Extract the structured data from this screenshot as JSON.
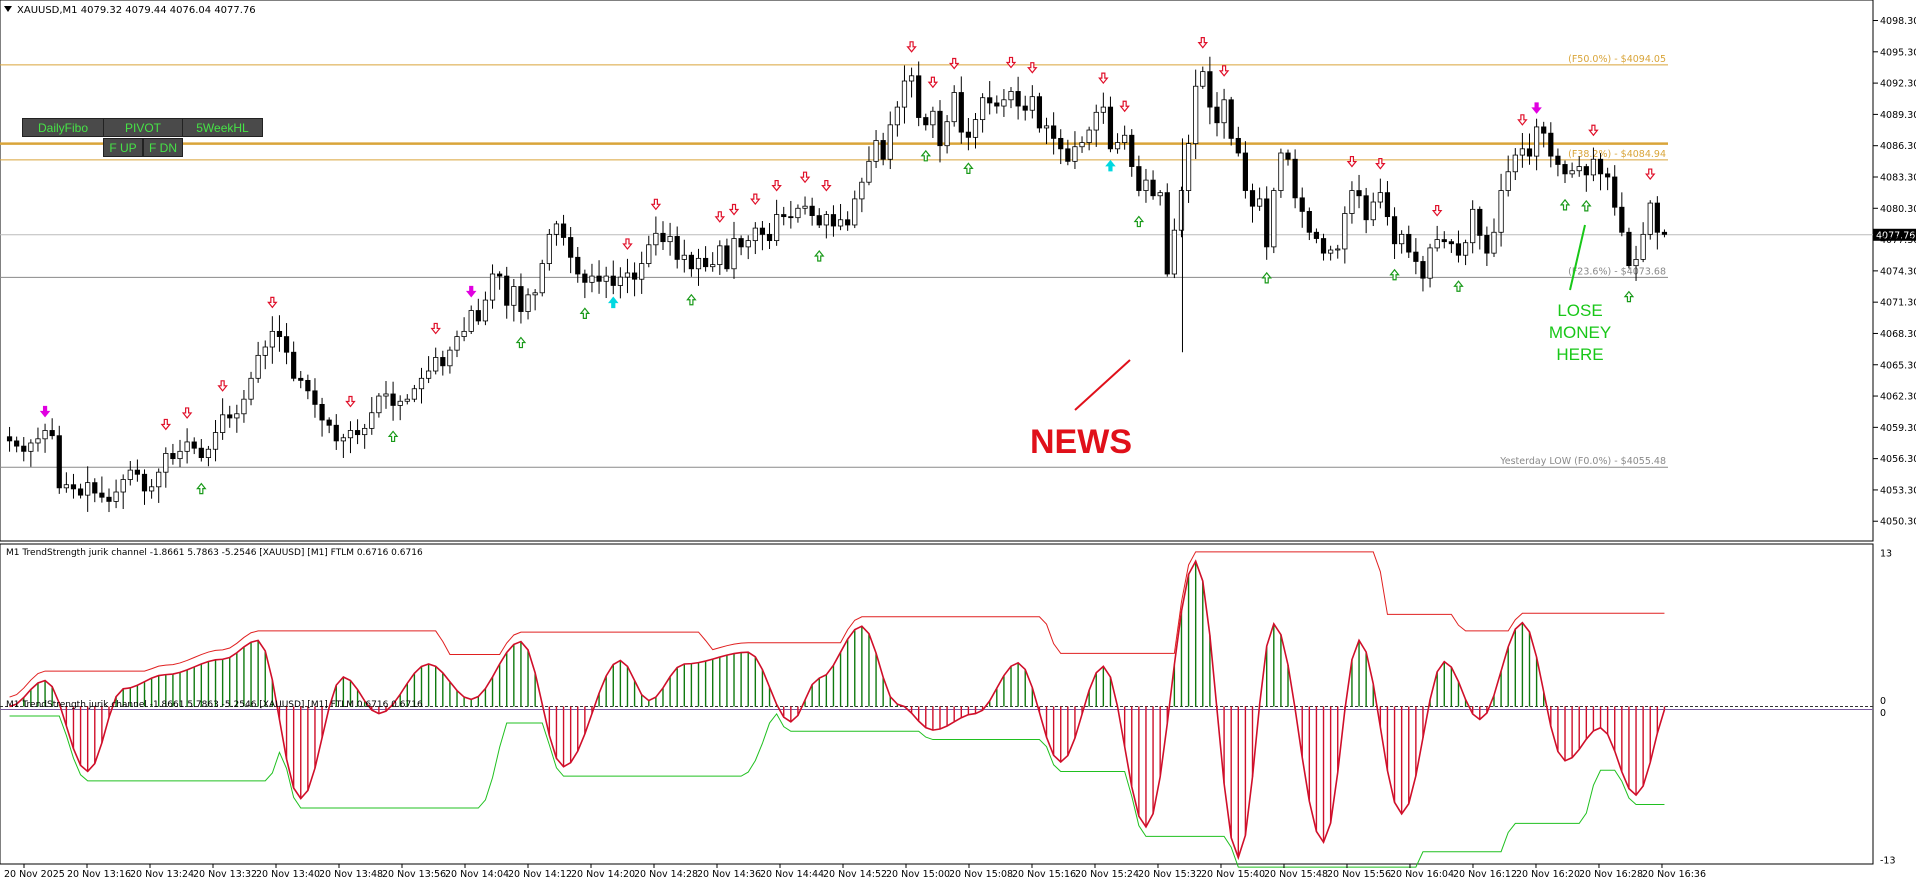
{
  "window": {
    "title_line": "XAUUSD,M1  4079.32 4079.44 4076.04 4077.76",
    "menu_icon": "triangle-down-icon"
  },
  "buttons": {
    "daily_fibo": "DailyFibo",
    "pivot": "PIVOT",
    "five_week_hl": "5WeekHL",
    "f_up": "F UP",
    "f_dn": "F DN"
  },
  "annotations": {
    "news": "NEWS",
    "lose_money": [
      "LOSE",
      "MONEY",
      "HERE"
    ]
  },
  "colors": {
    "bull_arrow": "#1a9a1a",
    "bear_arrow": "#e0102a",
    "cyan_arrow": "#00d8e0",
    "magenta_arrow": "#e000e0",
    "fibo_line": "#d9a53a",
    "bull_hist": "#0f7a0f",
    "bear_hist": "#d00f2a"
  },
  "chart_data": [
    {
      "type": "candlestick",
      "symbol": "XAUUSD",
      "timeframe": "M1",
      "ohlc_current": {
        "open": 4079.32,
        "high": 4079.44,
        "low": 4076.04,
        "close": 4077.76
      },
      "current_price_label": "4077.76",
      "ylim": [
        4048.5,
        4099.5
      ],
      "y_ticks": [
        "4098.30",
        "4095.30",
        "4092.30",
        "4089.30",
        "4086.30",
        "4083.30",
        "4080.30",
        "4077.30",
        "4074.30",
        "4071.30",
        "4068.30",
        "4065.30",
        "4062.30",
        "4059.30",
        "4056.30",
        "4053.30",
        "4050.30"
      ],
      "levels": [
        {
          "label": "(F50.0%) - $4094.05",
          "price": 4094.05,
          "color": "#d9a53a",
          "width": 1
        },
        {
          "label": "",
          "price": 4086.5,
          "color": "#d9a53a",
          "width": 2.5
        },
        {
          "label": "(F38.2%) - $4084.94",
          "price": 4084.94,
          "color": "#d9a53a",
          "width": 1
        },
        {
          "label": "(F23.6%) - $4073.68",
          "price": 4073.68,
          "color": "#8a8a8a",
          "width": 1
        },
        {
          "label": "Yesterday LOW (F0.0%) - $4055.48",
          "price": 4055.48,
          "color": "#8a8a8a",
          "width": 1
        }
      ],
      "close_series": [
        4058.0,
        4057.5,
        4057.0,
        4057.8,
        4058.2,
        4059.0,
        4058.5,
        4053.5,
        4053.8,
        4053.4,
        4052.8,
        4054.0,
        4053.0,
        4052.6,
        4052.2,
        4053.1,
        4054.3,
        4055.2,
        4054.8,
        4053.2,
        4053.6,
        4055.0,
        4056.8,
        4056.3,
        4057.0,
        4057.9,
        4057.3,
        4056.4,
        4057.2,
        4058.8,
        4060.5,
        4060.2,
        4060.6,
        4062.0,
        4064.0,
        4066.2,
        4067.0,
        4068.5,
        4068.0,
        4066.5,
        4064.0,
        4063.8,
        4062.8,
        4061.5,
        4060.0,
        4059.5,
        4058.0,
        4058.3,
        4059.0,
        4058.6,
        4059.2,
        4060.7,
        4062.3,
        4062.5,
        4061.4,
        4061.8,
        4062.0,
        4063.0,
        4064.0,
        4064.7,
        4066.0,
        4065.2,
        4066.7,
        4068.0,
        4068.5,
        4070.5,
        4069.5,
        4071.5,
        4074.0,
        4073.8,
        4071.0,
        4072.8,
        4070.4,
        4072.0,
        4072.2,
        4075.0,
        4077.8,
        4078.8,
        4077.5,
        4075.6,
        4074.0,
        4073.2,
        4073.8,
        4073.3,
        4073.8,
        4072.9,
        4073.7,
        4074.1,
        4073.5,
        4075.0,
        4076.8,
        4077.9,
        4077.1,
        4077.6,
        4075.4,
        4075.8,
        4074.5,
        4075.5,
        4074.7,
        4074.9,
        4076.7,
        4074.5,
        4077.4,
        4076.6,
        4077.2,
        4078.4,
        4077.8,
        4077.2,
        4079.7,
        4079.5,
        4079.4,
        4080.3,
        4080.5,
        4079.6,
        4078.7,
        4079.7,
        4078.6,
        4079.2,
        4078.7,
        4081.2,
        4082.8,
        4084.8,
        4086.8,
        4085.0,
        4088.3,
        4090.0,
        4092.5,
        4093.0,
        4089.0,
        4088.3,
        4089.6,
        4086.3,
        4088.6,
        4091.4,
        4087.6,
        4087.1,
        4088.8,
        4090.9,
        4090.4,
        4090.1,
        4090.7,
        4091.5,
        4090.1,
        4089.7,
        4091.0,
        4088.0,
        4088.2,
        4087.0,
        4086.0,
        4084.8,
        4086.2,
        4086.6,
        4087.8,
        4089.5,
        4090.0,
        4086.0,
        4086.6,
        4087.3,
        4084.3,
        4082.0,
        4083.0,
        4081.5,
        4081.8,
        4074.0,
        4078.2,
        4082.0,
        4086.5,
        4092.0,
        4093.4,
        4090.0,
        4088.5,
        4090.7,
        4087.0,
        4085.6,
        4082.0,
        4080.5,
        4081.2,
        4076.6,
        4082.0,
        4085.6,
        4085.0,
        4081.3,
        4080.0,
        4078.0,
        4077.4,
        4076.0,
        4076.3,
        4076.4,
        4079.8,
        4082.0,
        4081.5,
        4079.2,
        4080.9,
        4081.8,
        4079.5,
        4076.9,
        4077.8,
        4076.1,
        4075.2,
        4073.6,
        4076.5,
        4077.3,
        4077.1,
        4076.9,
        4075.8,
        4077.0,
        4080.2,
        4077.7,
        4076.0,
        4078.0,
        4082.0,
        4083.8,
        4085.4,
        4086.0,
        4085.3,
        4088.1,
        4087.5,
        4085.3,
        4084.5,
        4083.6,
        4083.9,
        4084.3,
        4083.5,
        4085.0,
        4083.6,
        4083.3,
        4080.4,
        4078.0,
        4074.8,
        4075.4,
        4077.8,
        4080.8,
        4078.0,
        4077.8
      ],
      "signals": [
        {
          "label": "bull-arrow",
          "count": 32
        },
        {
          "label": "bear-arrow",
          "count": 33
        },
        {
          "label": "cyan-up-arrow",
          "count": 6
        },
        {
          "label": "magenta-down-arrow",
          "count": 4
        }
      ],
      "x_tick_labels": [
        "20 Nov 2025",
        "20 Nov 13:16",
        "20 Nov 13:24",
        "20 Nov 13:32",
        "20 Nov 13:40",
        "20 Nov 13:48",
        "20 Nov 13:56",
        "20 Nov 14:04",
        "20 Nov 14:12",
        "20 Nov 14:20",
        "20 Nov 14:28",
        "20 Nov 14:36",
        "20 Nov 14:44",
        "20 Nov 14:52",
        "20 Nov 15:00",
        "20 Nov 15:08",
        "20 Nov 15:16",
        "20 Nov 15:24",
        "20 Nov 15:32",
        "20 Nov 15:40",
        "20 Nov 15:48",
        "20 Nov 15:56",
        "20 Nov 16:04",
        "20 Nov 16:12",
        "20 Nov 16:20",
        "20 Nov 16:28",
        "20 Nov 16:36"
      ]
    },
    {
      "type": "histogram",
      "label_1": "M1 TrendStrength jurik channel -1.8661 5.7863 -5.2546  [XAUUSD] [M1] FTLM 0.6716 0.6716",
      "label_2": "M1 TrendStrength jurik channel -1.8661 5.7863 -5.2546  [XAUUSD] [M1] FTLM 0.6716 0.6716",
      "y_ticks": [
        "13",
        "0",
        "0",
        "-13"
      ],
      "ylim": [
        -13,
        13
      ],
      "peaks": [
        {
          "i": 0,
          "v": 0
        },
        {
          "i": 5,
          "v": 2.2
        },
        {
          "i": 11,
          "v": -5.5
        },
        {
          "i": 16,
          "v": 1.5
        },
        {
          "i": 22,
          "v": 2.7
        },
        {
          "i": 30,
          "v": 4.0
        },
        {
          "i": 35,
          "v": 5.6
        },
        {
          "i": 41,
          "v": -7.8
        },
        {
          "i": 47,
          "v": 2.5
        },
        {
          "i": 52,
          "v": -0.6
        },
        {
          "i": 59,
          "v": 3.6
        },
        {
          "i": 65,
          "v": 0.6
        },
        {
          "i": 72,
          "v": 5.5
        },
        {
          "i": 78,
          "v": -5.1
        },
        {
          "i": 86,
          "v": 3.9
        },
        {
          "i": 90,
          "v": 0.5
        },
        {
          "i": 95,
          "v": 3.6
        },
        {
          "i": 104,
          "v": 4.6
        },
        {
          "i": 110,
          "v": -1.3
        },
        {
          "i": 114,
          "v": 2.4
        },
        {
          "i": 120,
          "v": 6.8
        },
        {
          "i": 125,
          "v": 0.2
        },
        {
          "i": 130,
          "v": -2.0
        },
        {
          "i": 136,
          "v": -0.6
        },
        {
          "i": 142,
          "v": 3.7
        },
        {
          "i": 148,
          "v": -4.7
        },
        {
          "i": 154,
          "v": 3.4
        },
        {
          "i": 160,
          "v": -10.2
        },
        {
          "i": 167,
          "v": 12.3
        },
        {
          "i": 173,
          "v": -12.8
        },
        {
          "i": 178,
          "v": 7.0
        },
        {
          "i": 185,
          "v": -11.5
        },
        {
          "i": 190,
          "v": 5.6
        },
        {
          "i": 196,
          "v": -9.1
        },
        {
          "i": 202,
          "v": 3.8
        },
        {
          "i": 207,
          "v": -1.1
        },
        {
          "i": 213,
          "v": 7.1
        },
        {
          "i": 219,
          "v": -4.6
        },
        {
          "i": 224,
          "v": -1.8
        },
        {
          "i": 229,
          "v": -7.5
        },
        {
          "i": 234,
          "v": 0.5
        }
      ]
    }
  ]
}
